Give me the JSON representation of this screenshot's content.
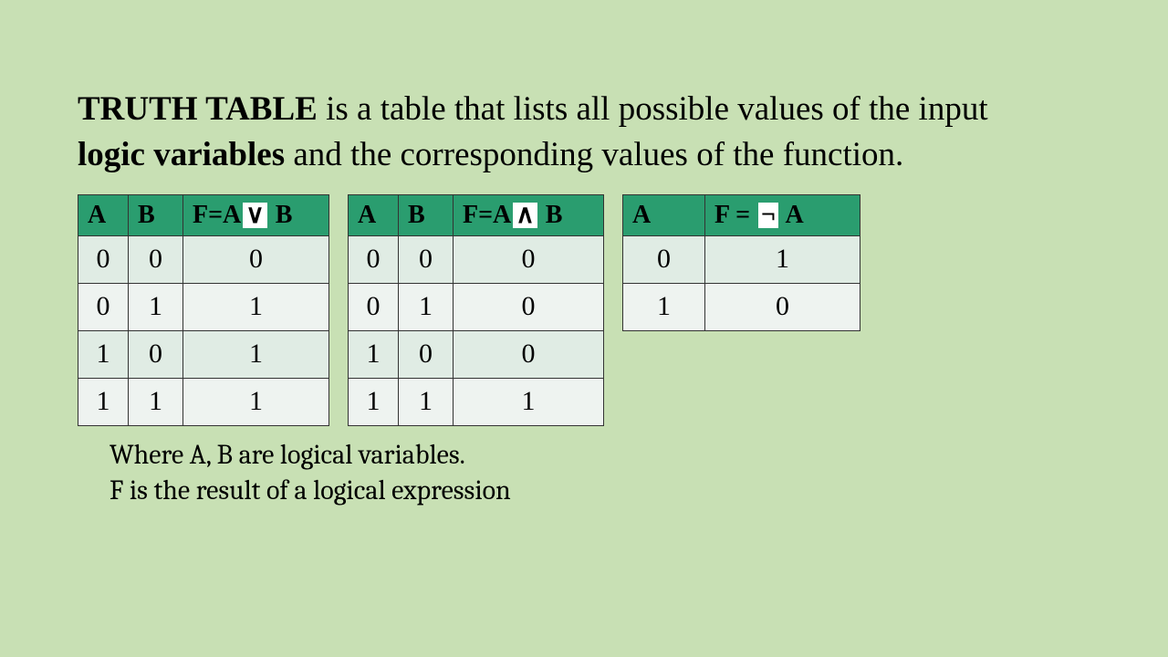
{
  "definition": {
    "b1": "TRUTH TABLE",
    "p1": " is a table that lists all possible values of the input ",
    "b2": "logic variables",
    "p2": " and the corresponding values of the function."
  },
  "tables": {
    "or": {
      "h1": "A",
      "h2": "B",
      "h3_pre": "F=A",
      "h3_op": "∨",
      "h3_post": " B",
      "rows": [
        {
          "a": "0",
          "b": "0",
          "f": "0"
        },
        {
          "a": "0",
          "b": "1",
          "f": "1"
        },
        {
          "a": "1",
          "b": "0",
          "f": "1"
        },
        {
          "a": "1",
          "b": "1",
          "f": "1"
        }
      ]
    },
    "and": {
      "h1": "A",
      "h2": "B",
      "h3_pre": "F=A",
      "h3_op": "∧",
      "h3_post": " B",
      "rows": [
        {
          "a": "0",
          "b": "0",
          "f": "0"
        },
        {
          "a": "0",
          "b": "1",
          "f": "0"
        },
        {
          "a": "1",
          "b": "0",
          "f": "0"
        },
        {
          "a": "1",
          "b": "1",
          "f": "1"
        }
      ]
    },
    "not": {
      "h1": "A",
      "h2_pre": "F = ",
      "h2_op": "¬",
      "h2_post": " A",
      "rows": [
        {
          "a": "0",
          "f": "1"
        },
        {
          "a": "1",
          "f": "0"
        }
      ]
    }
  },
  "footer": {
    "l1": "Where A, B are logical variables.",
    "l2": "F is the result of a logical expression"
  },
  "chart_data": [
    {
      "type": "table",
      "title": "OR truth table (F = A ∨ B)",
      "columns": [
        "A",
        "B",
        "F"
      ],
      "rows": [
        [
          0,
          0,
          0
        ],
        [
          0,
          1,
          1
        ],
        [
          1,
          0,
          1
        ],
        [
          1,
          1,
          1
        ]
      ]
    },
    {
      "type": "table",
      "title": "AND truth table (F = A ∧ B)",
      "columns": [
        "A",
        "B",
        "F"
      ],
      "rows": [
        [
          0,
          0,
          0
        ],
        [
          0,
          1,
          0
        ],
        [
          1,
          0,
          0
        ],
        [
          1,
          1,
          1
        ]
      ]
    },
    {
      "type": "table",
      "title": "NOT truth table (F = ¬A)",
      "columns": [
        "A",
        "F"
      ],
      "rows": [
        [
          0,
          1
        ],
        [
          1,
          0
        ]
      ]
    }
  ]
}
